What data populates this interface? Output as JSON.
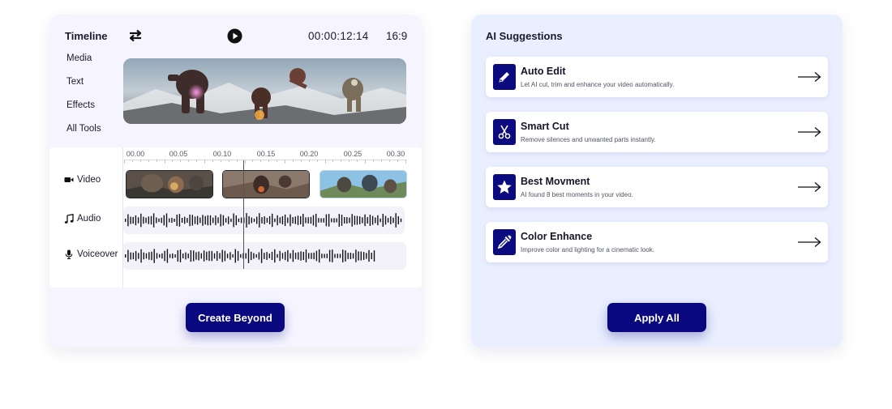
{
  "timeline": {
    "title": "Timeline",
    "timecode": "00:00:12:14",
    "aspect_ratio": "16:9",
    "menu": [
      "Media",
      "Text",
      "Effects",
      "All Tools"
    ],
    "ruler": [
      "00.00",
      "00.05",
      "00.10",
      "00.15",
      "00.20",
      "00.25",
      "00.30"
    ],
    "tracks": {
      "video": "Video",
      "audio": "Audio",
      "voiceover": "Voiceover"
    },
    "create_button": "Create Beyond",
    "icons": {
      "swap": "swap-arrows-icon",
      "play": "play-icon",
      "video": "video-camera-icon",
      "audio": "music-note-icon",
      "voiceover": "microphone-icon"
    }
  },
  "ai": {
    "title": "AI Suggestions",
    "cards": [
      {
        "title": "Auto Edit",
        "desc": "Let AI cut, trim and enhance your video automatically.",
        "icon": "pencil-icon"
      },
      {
        "title": "Smart Cut",
        "desc": "Remove silences and unwanted parts instantly.",
        "icon": "scissors-icon"
      },
      {
        "title": "Best Movment",
        "desc": "AI found 8 best moments in your video.",
        "icon": "star-icon"
      },
      {
        "title": "Color Enhance",
        "desc": "Improve color and lighting for a cinematic look.",
        "icon": "eyedropper-icon"
      }
    ],
    "apply_button": "Apply All"
  },
  "colors": {
    "accent": "#09087e",
    "left_panel_bg": "#f6f5ff",
    "right_panel_bg": "#e9efff",
    "text": "#1a1a2e"
  }
}
